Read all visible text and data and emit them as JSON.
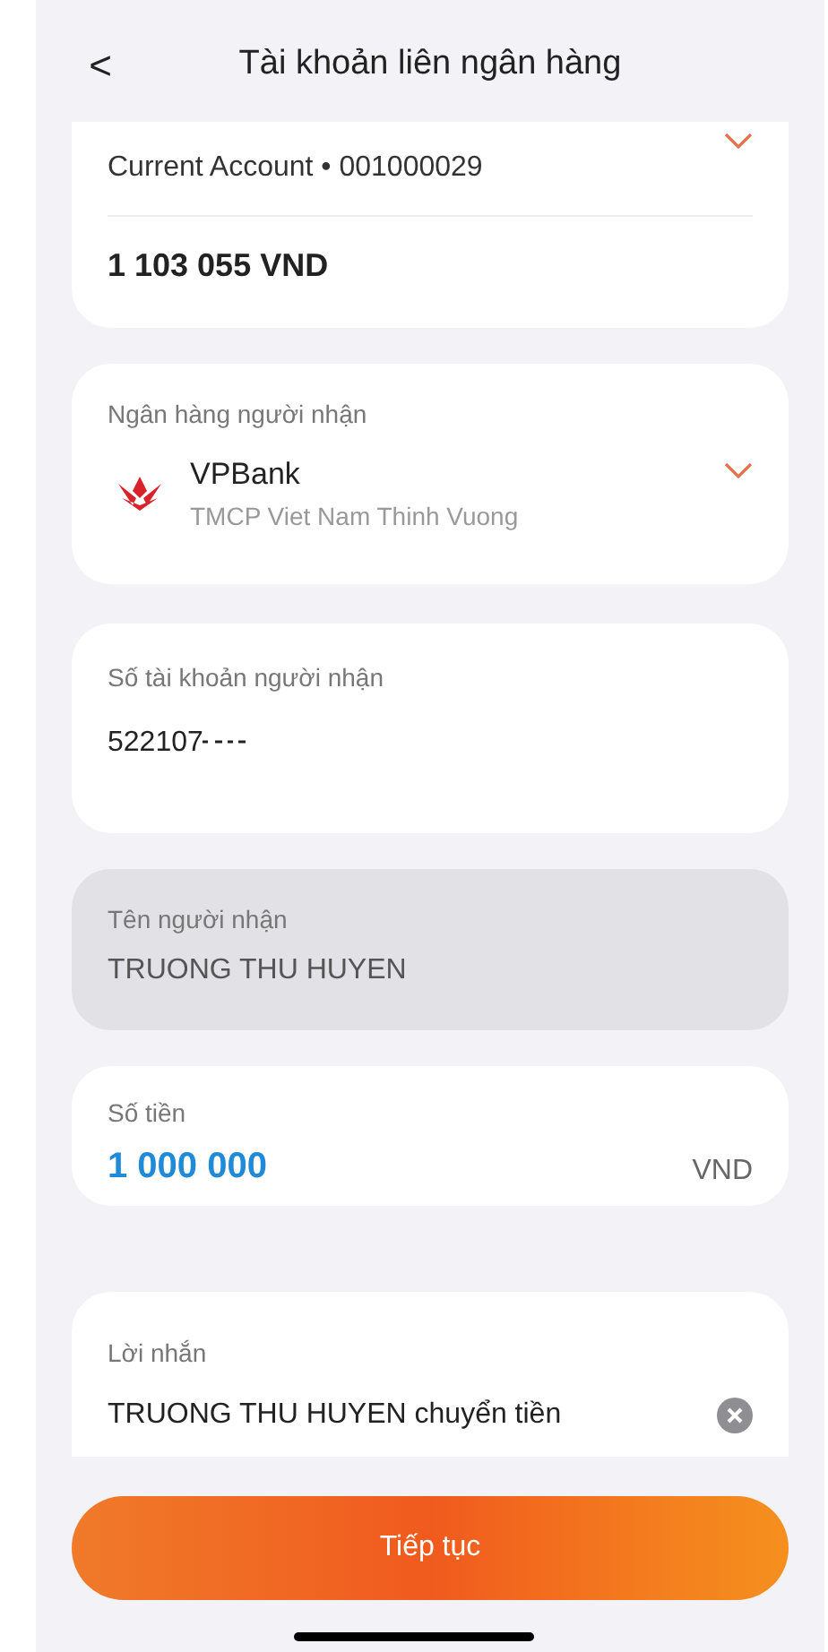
{
  "header": {
    "back": "<",
    "title": "Tài khoản liên ngân hàng"
  },
  "source_account": {
    "account": "Current Account • 001000029",
    "balance": "1 103 055 VND"
  },
  "bank": {
    "label": "Ngân hàng người nhận",
    "name": "VPBank",
    "full_name": "TMCP Viet Nam Thinh Vuong"
  },
  "account_number": {
    "label": "Số tài khoản người nhận",
    "value": "522107"
  },
  "recipient_name": {
    "label": "Tên người nhận",
    "value": "TRUONG THU HUYEN",
    "disabled": true
  },
  "amount": {
    "label": "Số tiền",
    "value": "1 000 000",
    "currency": "VND"
  },
  "message": {
    "label": "Lời nhắn",
    "value": "TRUONG THU HUYEN chuyển tiền"
  },
  "button": "Tiếp tục"
}
